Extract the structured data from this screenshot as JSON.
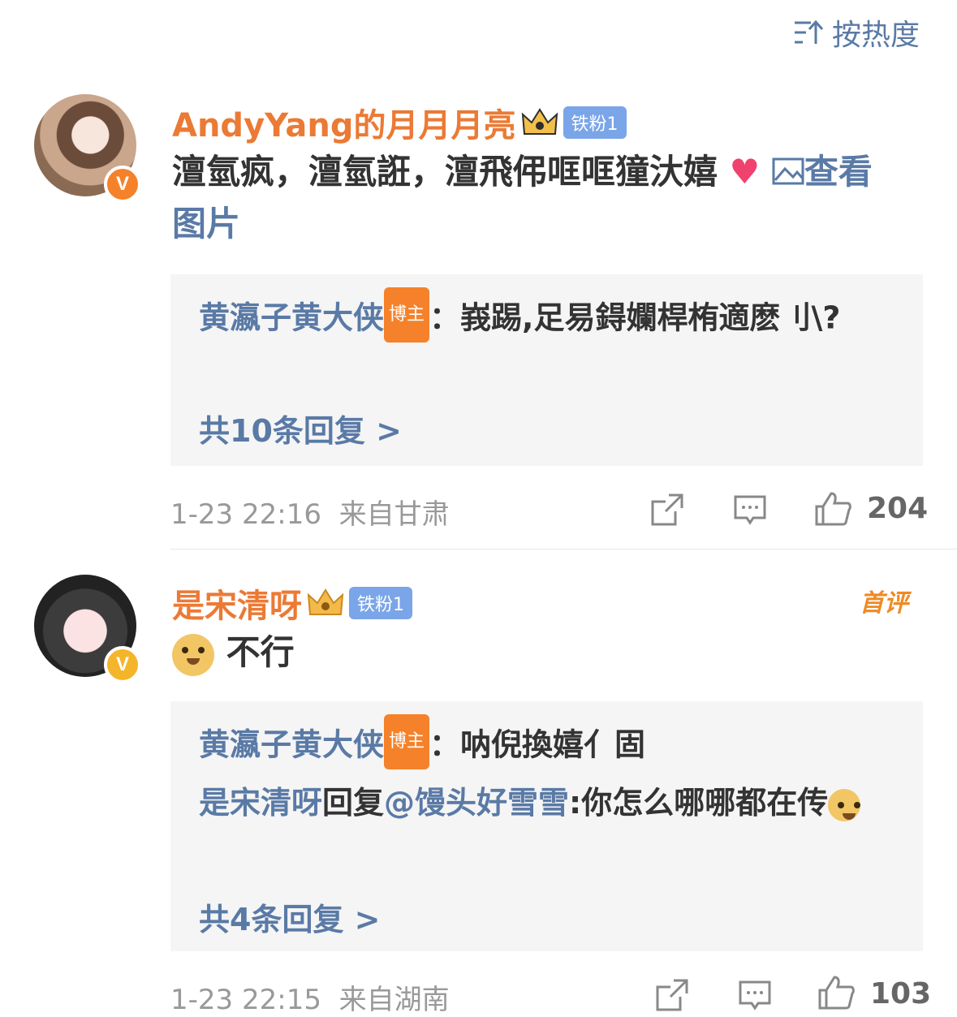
{
  "sort": {
    "label": "按热度"
  },
  "comments": [
    {
      "username": "AndyYang的月月月亮",
      "fan_badge": "铁粉1",
      "text": "澶氫疯，澶氫誑，澶飛伄哐哐獞汏嬉",
      "image_link": "查看图片",
      "replies": [
        {
          "author": "黄瀛子黄大侠",
          "host_badge": "博主",
          "text": "：峩踢,足易鍀孄桿栯適麽刂\\?"
        }
      ],
      "more_replies": "共10条回复 >",
      "time": "1-23 22:16",
      "location": "来自甘肃",
      "likes": "204"
    },
    {
      "username": "是宋清呀",
      "fan_badge": "铁粉1",
      "first_tag": "首评",
      "text": "不行",
      "replies": [
        {
          "author": "黄瀛子黄大侠",
          "host_badge": "博主",
          "text": "：呐倪換嬉亻固"
        },
        {
          "author": "是宋清呀",
          "mid": "回复",
          "mention": "@馒头好雪雪",
          "text": ":你怎么哪哪都在传"
        }
      ],
      "more_replies": "共4条回复 >",
      "time": "1-23 22:15",
      "location": "来自湖南",
      "likes": "103"
    }
  ],
  "icons": [
    "sort-icon",
    "verified-icon",
    "crown-icon",
    "picture-icon",
    "share-icon",
    "comment-icon",
    "like-icon",
    "doge-emoji"
  ],
  "colors": {
    "username": "#eb7a35",
    "link": "#5a7aa6",
    "badge_fan": "#7aa5e8",
    "badge_host": "#f5822a",
    "verified": "#f5822a"
  }
}
